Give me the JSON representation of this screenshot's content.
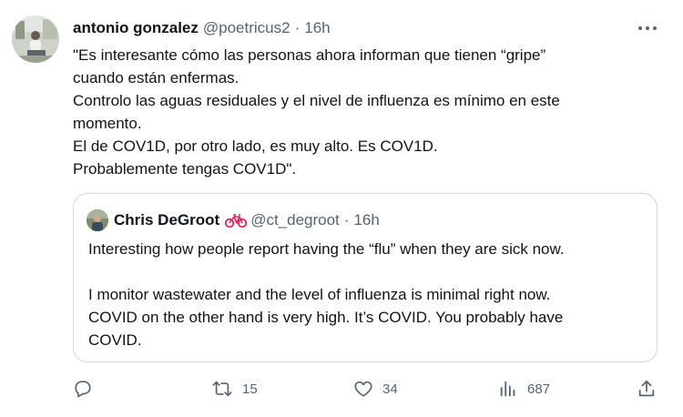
{
  "tweet": {
    "author_name": "antonio gonzalez",
    "author_handle": "@poetricus2",
    "separator": "·",
    "time": "16h",
    "text_lines": [
      "\"Es interesante cómo las personas ahora informan que tienen “gripe”",
      "cuando están enfermas.",
      "Controlo las aguas residuales y el nivel de influenza es mínimo en este",
      "momento.",
      "El de COV1D, por otro lado, es muy alto. Es COV1D.",
      "Probablemente tengas COV1D\"."
    ]
  },
  "quote": {
    "author_name": "Chris DeGroot",
    "author_handle": "@ct_degroot",
    "separator": "·",
    "time": "16h",
    "text_lines": [
      "Interesting how people report having the “flu” when they are sick now.",
      "",
      "I monitor wastewater and the level of influenza is minimal right now.",
      "COVID on the other hand is very high. It’s COVID. You probably have",
      "COVID."
    ]
  },
  "actions": {
    "reply_icon": "reply-icon",
    "retweet_icon": "retweet-icon",
    "retweet_count": "15",
    "like_icon": "heart-icon",
    "like_count": "34",
    "views_icon": "views-icon",
    "views_count": "687",
    "share_icon": "share-icon"
  },
  "colors": {
    "text": "#0f1419",
    "secondary": "#536471",
    "border": "#cfd9de",
    "bike": "#e0245e"
  }
}
